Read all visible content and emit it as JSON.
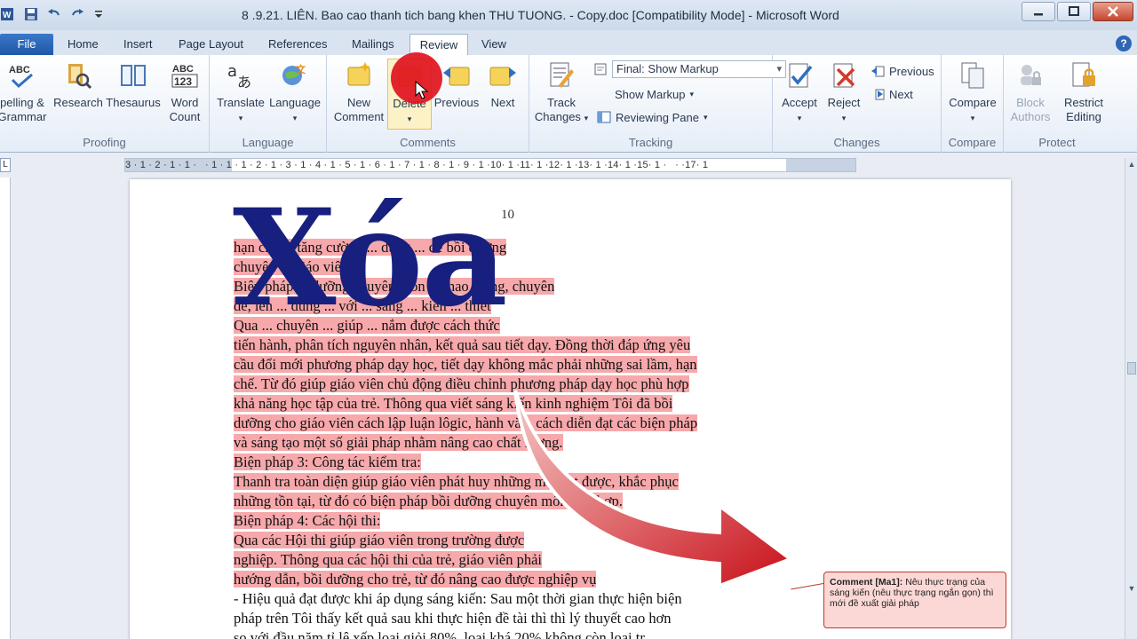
{
  "window": {
    "title": "8 .9.21. LIÊN. Bao cao thanh tich bang khen THU TUONG. - Copy.doc [Compatibility Mode] - Microsoft Word"
  },
  "tabs": [
    "File",
    "Home",
    "Insert",
    "Page Layout",
    "References",
    "Mailings",
    "Review",
    "View"
  ],
  "active_tab": "Review",
  "ribbon": {
    "proofing": {
      "label": "Proofing",
      "spelling": "pelling &",
      "spelling2": "Grammar",
      "research": "Research",
      "thesaurus": "Thesaurus",
      "word_count": "Word",
      "word_count2": "Count"
    },
    "language": {
      "label": "Language",
      "translate": "Translate",
      "language_btn": "Language"
    },
    "comments": {
      "label": "Comments",
      "new_comment": "New",
      "new_comment2": "Comment",
      "delete": "Delete",
      "previous": "Previous",
      "next": "Next"
    },
    "tracking": {
      "label": "Tracking",
      "track_changes": "Track",
      "track_changes2": "Changes",
      "markup_mode": "Final: Show Markup",
      "show_markup": "Show Markup",
      "reviewing_pane": "Reviewing Pane"
    },
    "changes": {
      "label": "Changes",
      "accept": "Accept",
      "reject": "Reject",
      "previous": "Previous",
      "next": "Next"
    },
    "compare": {
      "label": "Compare",
      "compare_btn": "Compare"
    },
    "protect": {
      "label": "Protect",
      "block_authors": "Block",
      "block_authors2": "Authors",
      "restrict_editing": "Restrict",
      "restrict_editing2": "Editing"
    }
  },
  "ruler": {
    "ticks": "3 · 1 · 2 · 1 · 1 ·   · 1 · 1 · 1 · 2 · 1 · 3 · 1 · 4 · 1 · 5 · 1 · 6 · 1 · 7 · 1 · 8 · 1 · 9 · 1 ·10· 1 ·11· 1 ·12· 1 ·13· 1 ·14· 1 ·15· 1 ·   · ·17· 1"
  },
  "document": {
    "page_number": "10",
    "lines": [
      {
        "text": "hạn chế ... tăng cường ... dụng ... để bồi dưỡng",
        "hl": true
      },
      {
        "text": "chuyên ... giáo viên",
        "hl": true
      },
      {
        "text": "Biện pháp ... dưỡng chuyên môn ... thao giảng, chuyên",
        "hl": true
      },
      {
        "text": "đề, lên ... đúng ... với ... sáng ... kiến ... thiết",
        "hl": true
      },
      {
        "text": "Qua ... chuyên ... giúp ... nắm được cách thức",
        "hl": true
      },
      {
        "text": "tiến hành, phân tích nguyên nhân, kết quả sau tiết dạy. Đồng thời đáp ứng yêu",
        "hl": true
      },
      {
        "text": "cầu đổi mới phương pháp dạy học, tiết dạy không mắc phải những sai lầm, hạn",
        "hl": true
      },
      {
        "text": "chế. Từ đó giúp giáo viên chủ động điều chỉnh phương pháp dạy học phù hợp",
        "hl": true
      },
      {
        "text": "khả năng học tập của trẻ. Thông qua viết sáng kiến kinh nghiệm Tôi đã bồi",
        "hl": true
      },
      {
        "text": "dưỡng cho giáo viên cách lập luận lôgic, hành văn, cách diễn đạt các biện pháp",
        "hl": true
      },
      {
        "text": "và sáng tạo một số giải pháp nhằm nâng cao chất lượng.",
        "hl": true
      },
      {
        "text": "Biện pháp 3: Công tác kiểm tra:",
        "hl": true
      },
      {
        "text": "Thanh tra toàn diện giúp giáo viên phát huy những mặt đạt được, khắc phục",
        "hl": true
      },
      {
        "text": "những tồn tại, từ đó có biện pháp bồi dưỡng chuyên môn phù hợp.",
        "hl": true
      },
      {
        "text": "Biện pháp 4: Các hội thi:",
        "hl": true
      },
      {
        "text": "Qua các Hội thi giúp giáo viên trong trường được",
        "hl": true
      },
      {
        "text": "nghiệp. Thông qua các hội thi của trẻ, giáo viên phải",
        "hl": true
      },
      {
        "text": "hướng dẫn, bồi dưỡng cho trẻ, từ đó nâng cao được nghiệp vụ",
        "hl": true
      },
      {
        "text": "- Hiệu quả đạt được khi áp dụng sáng kiến: Sau một thời gian thực hiện biện",
        "hl": false
      },
      {
        "text": "pháp trên Tôi thấy kết quả sau khi thực hiện đề tài thì thì lý thuyết cao hơn",
        "hl": false
      },
      {
        "text": "so với đầu năm tỉ lệ xếp loại giỏi 80%, loại khá 20% không còn loại tr...",
        "hl": false
      }
    ]
  },
  "comment": {
    "label": "Comment [Ma1]:",
    "text": "Nêu thực trạng của sáng kiến (nêu thực trạng ngắn gọn) thì mới đề xuất giải pháp"
  },
  "overlay": {
    "big_text": "Xóa"
  },
  "colors": {
    "highlight": "#f7a8ab",
    "overlay_text": "#17207e",
    "red_dot": "#e0141e",
    "arrow": "#c8101a"
  }
}
